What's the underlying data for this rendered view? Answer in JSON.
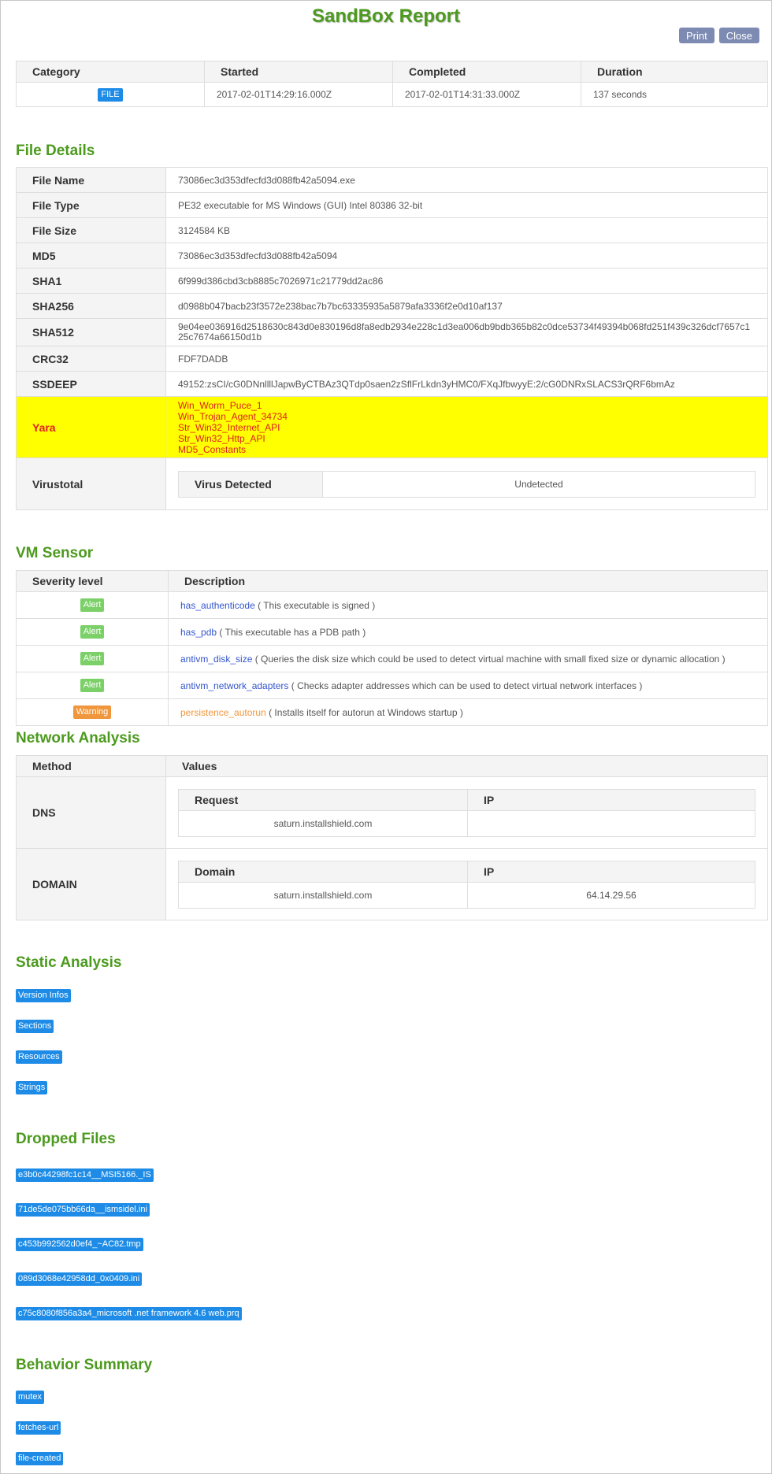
{
  "header": {
    "title": "SandBox Report",
    "print_label": "Print",
    "close_label": "Close"
  },
  "summary": {
    "headers": [
      "Category",
      "Started",
      "Completed",
      "Duration"
    ],
    "category_badge": "FILE",
    "started": "2017-02-01T14:29:16.000Z",
    "completed": "2017-02-01T14:31:33.000Z",
    "duration": "137 seconds"
  },
  "file_details": {
    "title": "File Details",
    "file_name_label": "File Name",
    "file_name": "73086ec3d353dfecfd3d088fb42a5094.exe",
    "file_type_label": "File Type",
    "file_type": "PE32 executable for MS Windows (GUI) Intel 80386 32-bit",
    "file_size_label": "File Size",
    "file_size": "3124584 KB",
    "md5_label": "MD5",
    "md5": "73086ec3d353dfecfd3d088fb42a5094",
    "sha1_label": "SHA1",
    "sha1": "6f999d386cbd3cb8885c7026971c21779dd2ac86",
    "sha256_label": "SHA256",
    "sha256": "d0988b047bacb23f3572e238bac7b7bc63335935a5879afa3336f2e0d10af137",
    "sha512_label": "SHA512",
    "sha512_line1": "9e04ee036916d2518630c843d0e830196d8fa8edb2934e228c1d3ea006db9bdb365b82c0dce53734f49394b068fd251f439c326dcf7657c1",
    "sha512_line2": "25c7674a66150d1b",
    "crc32_label": "CRC32",
    "crc32": "FDF7DADB",
    "ssdeep_label": "SSDEEP",
    "ssdeep": "49152:zsCI/cG0DNnllllJapwByCTBAz3QTdp0saen2zSflFrLkdn3yHMC0/FXqJfbwyyE:2/cG0DNRxSLACS3rQRF6bmAz",
    "yara_label": "Yara",
    "yara": [
      "Win_Worm_Puce_1",
      "Win_Trojan_Agent_34734",
      "Str_Win32_Internet_API",
      "Str_Win32_Http_API",
      "MD5_Constants"
    ],
    "virustotal_label": "Virustotal",
    "virus_detected_label": "Virus Detected",
    "virus_detected_value": "Undetected"
  },
  "vm_sensor": {
    "title": "VM Sensor",
    "headers": [
      "Severity level",
      "Description"
    ],
    "rows": [
      {
        "level": "Alert",
        "name": "has_authenticode",
        "desc": "( This executable is signed )"
      },
      {
        "level": "Alert",
        "name": "has_pdb",
        "desc": "( This executable has a PDB path )"
      },
      {
        "level": "Alert",
        "name": "antivm_disk_size",
        "desc": "( Queries the disk size which could be used to detect virtual machine with small fixed size or dynamic allocation )"
      },
      {
        "level": "Alert",
        "name": "antivm_network_adapters",
        "desc": "( Checks adapter addresses which can be used to detect virtual network interfaces )"
      },
      {
        "level": "Warning",
        "name": "persistence_autorun",
        "desc": "( Installs itself for autorun at Windows startup )"
      }
    ]
  },
  "network": {
    "title": "Network Analysis",
    "headers": [
      "Method",
      "Values"
    ],
    "dns_label": "DNS",
    "dns_headers": [
      "Request",
      "IP"
    ],
    "dns_request": "saturn.installshield.com",
    "dns_ip": "",
    "domain_label": "DOMAIN",
    "domain_headers": [
      "Domain",
      "IP"
    ],
    "domain_value": "saturn.installshield.com",
    "domain_ip": "64.14.29.56"
  },
  "static_analysis": {
    "title": "Static Analysis",
    "items": [
      "Version Infos",
      "Sections",
      "Resources",
      "Strings"
    ]
  },
  "dropped_files": {
    "title": "Dropped Files",
    "items": [
      "e3b0c44298fc1c14__MSI5166._IS",
      "71de5de075bb66da__ismsidel.ini",
      "c453b992562d0ef4_~AC82.tmp",
      "089d3068e42958dd_0x0409.ini",
      "c75c8080f856a3a4_microsoft .net framework 4.6 web.prq"
    ]
  },
  "behavior": {
    "title": "Behavior Summary",
    "items": [
      "mutex",
      "fetches-url",
      "file-created"
    ]
  }
}
